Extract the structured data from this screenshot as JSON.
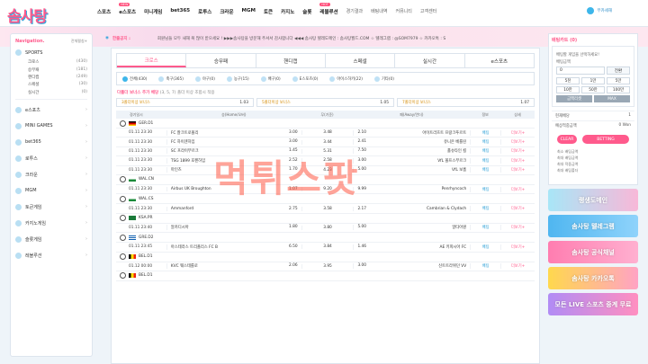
{
  "header": {
    "logo": "솜사탕",
    "nav": [
      {
        "label": "스포츠",
        "sub": false,
        "badge": ""
      },
      {
        "label": "e스포츠",
        "sub": false,
        "badge": "NEW"
      },
      {
        "label": "미니게임",
        "sub": false,
        "badge": ""
      },
      {
        "label": "bet365",
        "sub": false,
        "badge": ""
      },
      {
        "label": "로투스",
        "sub": false,
        "badge": ""
      },
      {
        "label": "크라운",
        "sub": false,
        "badge": ""
      },
      {
        "label": "MGM",
        "sub": false,
        "badge": ""
      },
      {
        "label": "토큰",
        "sub": false,
        "badge": ""
      },
      {
        "label": "카지노",
        "sub": false,
        "badge": ""
      },
      {
        "label": "슬롯",
        "sub": false,
        "badge": ""
      },
      {
        "label": "레블루션",
        "sub": false,
        "badge": "HOT"
      },
      {
        "label": "경기결과",
        "sub": true,
        "badge": ""
      },
      {
        "label": "배팅내역",
        "sub": true,
        "badge": ""
      },
      {
        "label": "커뮤니티",
        "sub": true,
        "badge": ""
      },
      {
        "label": "고객센터",
        "sub": true,
        "badge": ""
      }
    ],
    "user": "무카세해"
  },
  "sidebar": {
    "title": "Navigation.",
    "expand": "전체펼침+",
    "sports_label": "SPORTS",
    "sports_sub": [
      {
        "name": "크로스",
        "count": "(430)"
      },
      {
        "name": "승무패",
        "count": "(181)"
      },
      {
        "name": "핸디캡",
        "count": "(249)"
      },
      {
        "name": "스페셜",
        "count": "(30)"
      },
      {
        "name": "실시간",
        "count": "(0)"
      }
    ],
    "items": [
      "e스포츠",
      "MINI GAMES",
      "bet365",
      "로투스",
      "크라운",
      "MGM",
      "토큰게임",
      "카지노게임",
      "슬롯게임",
      "레블루션"
    ]
  },
  "notice": {
    "label": "한줄공지 :",
    "text": "회원님들 모두 새해 복 많이 받으세요 ! ▶▶▶솜사탕을 방문해 주셔서 감사합니다 ◀◀◀ 솜사탕 텔레도메인 : 솜사탕월드.COM ☆ 텔레그램 : @SOM7979 ☆ 카카오톡 : S"
  },
  "tabs": [
    "크로스",
    "승무패",
    "핸디캡",
    "스페셜",
    "실시간",
    "e스포츠"
  ],
  "sport_filters": [
    "전체(430)",
    "축구(365)",
    "야구(0)",
    "농구(15)",
    "배구(0)",
    "E스포츠(0)",
    "아이스하키(22)",
    "기타(0)"
  ],
  "bonus": {
    "title": "다폴더 보너스 추가 배당",
    "note": "(3, 5, 7) 폴더 이상 조합시 적용",
    "items": [
      {
        "label": "3폴더이상 보너스",
        "value": "1.03"
      },
      {
        "label": "5폴더이상 보너스",
        "value": "1.05"
      },
      {
        "label": "7폴더이상 보너스",
        "value": "1.07"
      }
    ]
  },
  "table_head": {
    "time": "경기일시",
    "home": "승(Home/오버)",
    "draw": "무(기준)",
    "away": "패(Away/언더)",
    "info": "정보",
    "more": "상세"
  },
  "leagues": [
    {
      "name": "GER.D1",
      "flag": "ger",
      "rows": [
        {
          "time": "01.11 23:30",
          "home": "FC 잘크트로폴리",
          "h_odds": "3.00",
          "draw": "3.48",
          "away": "2.10",
          "a_team": "아이트라흐트 프랑크푸르트"
        },
        {
          "time": "01.11 23:30",
          "home": "FC 하이덴하임",
          "h_odds": "3.00",
          "draw": "3.44",
          "away": "2.41",
          "a_team": "유니온 베를린"
        },
        {
          "time": "01.11 23:30",
          "home": "SC 프라이부르크",
          "h_odds": "1.45",
          "draw": "5.31",
          "away": "7.50",
          "a_team": "홀슈타인 킬"
        },
        {
          "time": "01.11 23:30",
          "home": "TSG 1899 호펜하임",
          "h_odds": "2.52",
          "draw": "2.58",
          "away": "3.00",
          "a_team": "VfL 볼프스부르크"
        },
        {
          "time": "01.11 23:30",
          "home": "마인츠",
          "h_odds": "1.70",
          "draw": "4.23",
          "away": "5.00",
          "a_team": "VfL 보훔"
        }
      ]
    },
    {
      "name": "WAL.CN",
      "flag": "wal",
      "rows": [
        {
          "time": "01.11 23:30",
          "home": "Airbus UK Broughton",
          "h_odds": "1.07",
          "draw": "9.20",
          "away": "9.99",
          "a_team": "Penrhyncoch"
        }
      ]
    },
    {
      "name": "WAL.CS",
      "flag": "wal",
      "rows": [
        {
          "time": "01.11 23:30",
          "home": "Ammanford",
          "h_odds": "2.75",
          "draw": "3.58",
          "away": "2.17",
          "a_team": "Cambrian & Clydach"
        }
      ]
    },
    {
      "name": "KSA.PR",
      "flag": "ksa",
      "rows": [
        {
          "time": "01.11 23:40",
          "home": "알카디시아",
          "h_odds": "1.80",
          "draw": "3.80",
          "away": "5.00",
          "a_team": "알타아원"
        }
      ]
    },
    {
      "name": "GRE.D2",
      "flag": "gre",
      "rows": [
        {
          "time": "01.11 23:45",
          "home": "아스테라스 트리폴리스 FC B",
          "h_odds": "6.50",
          "draw": "3.84",
          "away": "1.46",
          "a_team": "AE 키피시아 FC"
        }
      ]
    },
    {
      "name": "BEL.D1",
      "flag": "bel",
      "rows": [
        {
          "time": "01.12 00:00",
          "home": "KVC 웨스테를로",
          "h_odds": "2.06",
          "draw": "3.95",
          "away": "3.00",
          "a_team": "신트트라위던 VV"
        }
      ]
    },
    {
      "name": "BEL.D1",
      "flag": "bel",
      "rows": []
    }
  ],
  "row_info": "배팅",
  "row_more": "더보기+",
  "watermark": "먹튀스팟",
  "cart": {
    "title": "배팅카트 (0)",
    "empty": "배팅할 게임을 선택하세요!",
    "amount_label": "배팅금액",
    "amount": "0",
    "reset": "전환",
    "chips": [
      "5천",
      "1만",
      "5만",
      "10만",
      "50만",
      "100만"
    ],
    "actions": [
      "금액리셋",
      "MAX"
    ],
    "odds_label": "현재배당",
    "odds": "1",
    "win_label": "예상적중금액",
    "win": "0 Won",
    "clear": "CLEAR",
    "bet": "BETTING",
    "notes": [
      "최소 배팅금액",
      "최대 배팅금액",
      "최대 적중금액",
      "최대 배팅폴더"
    ]
  },
  "ads": [
    "랭생도메인",
    "솜사탕 텔레그램",
    "솜사탕 공식채널",
    "솜사탕 카카오톡",
    "모든 LIVE 스포츠 중계 무료"
  ],
  "colors": {
    "accent": "#ff5a8c",
    "blue": "#3db6ea"
  }
}
